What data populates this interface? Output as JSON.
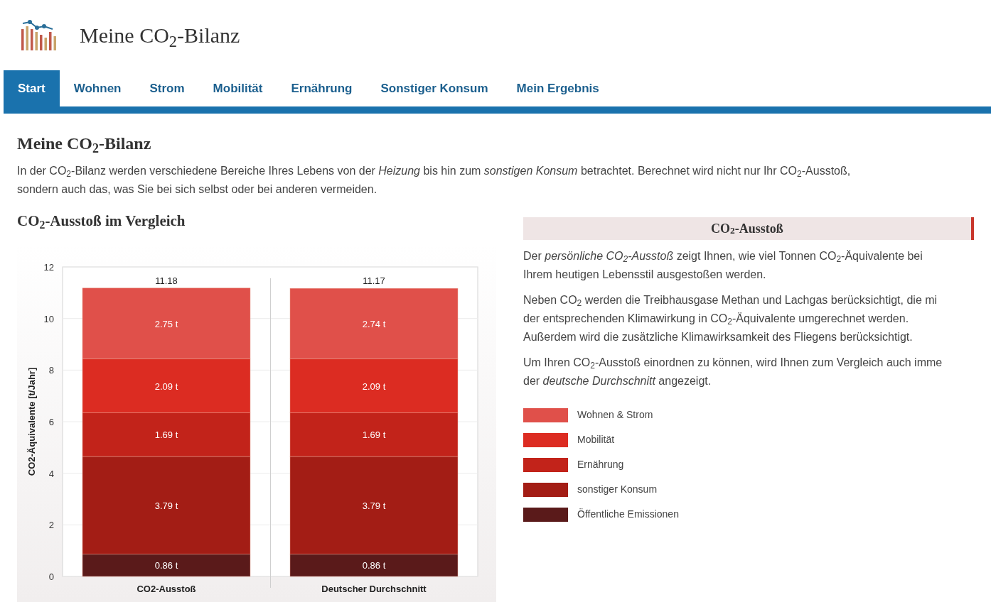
{
  "header": {
    "title": "Meine CO$_{2}$-Bilanz"
  },
  "tabs": [
    {
      "label": "Start",
      "selected": true
    },
    {
      "label": "Wohnen",
      "selected": false
    },
    {
      "label": "Strom",
      "selected": false
    },
    {
      "label": "Mobilität",
      "selected": false
    },
    {
      "label": "Ernährung",
      "selected": false
    },
    {
      "label": "Sonstiger Konsum",
      "selected": false
    },
    {
      "label": "Mein Ergebnis",
      "selected": false
    }
  ],
  "intro": {
    "heading": "Meine CO$_{2}$-Bilanz",
    "lines": [
      "In der CO$_{2}$-Bilanz werden verschiedene Bereiche Ihres Lebens von der *Heizung* bis hin zum *sonstigen Konsum* betrachtet. Berechnet wird nicht nur Ihr CO$_{2}$-Ausstoß,",
      "sondern auch das, was Sie bei sich selbst oder bei anderen vermeiden."
    ]
  },
  "comparison": {
    "heading": "CO$_{2}$-Ausstoß im Vergleich",
    "chart_data": {
      "type": "bar",
      "stacked": true,
      "grid": true,
      "ylabel": "CO2-Äquivalente [t/Jahr]",
      "categories": [
        "CO2-Ausstoß",
        "Deutscher Durchschnitt"
      ],
      "ylim": [
        0,
        12
      ],
      "yticks": [
        0,
        2,
        4,
        6,
        8,
        10,
        12
      ],
      "series": [
        {
          "name": "Öffentliche Emissionen",
          "color": "#5a1a1a",
          "values": [
            0.86,
            0.86
          ],
          "value_labels": [
            "0.86 t",
            "0.86 t"
          ]
        },
        {
          "name": "sonstiger Konsum",
          "color": "#a31d15",
          "values": [
            3.79,
            3.79
          ],
          "value_labels": [
            "3.79 t",
            "3.79 t"
          ]
        },
        {
          "name": "Ernährung",
          "color": "#c2231a",
          "values": [
            1.69,
            1.69
          ],
          "value_labels": [
            "1.69 t",
            "1.69 t"
          ]
        },
        {
          "name": "Mobilität",
          "color": "#dc2c22",
          "values": [
            2.09,
            2.09
          ],
          "value_labels": [
            "2.09 t",
            "2.09 t"
          ]
        },
        {
          "name": "Wohnen & Strom",
          "color": "#e0504a",
          "values": [
            2.75,
            2.74
          ],
          "value_labels": [
            "2.75 t",
            "2.74 t"
          ]
        }
      ],
      "annotations": [
        "11.18",
        "11.17"
      ]
    }
  },
  "info": {
    "heading": "CO$_{2}$-Ausstoß",
    "paragraphs": [
      {
        "lines": [
          "Der *persönliche CO$_{2}$-Ausstoß* zeigt Ihnen, wie viel Tonnen CO$_{2}$-Äquivalente bei",
          "Ihrem heutigen Lebensstil ausgestoßen werden."
        ]
      },
      {
        "lines": [
          "Neben CO$_{2}$ werden die Treibhausgase Methan und Lachgas berücksichtigt, die mi",
          "der entsprechenden Klimawirkung in CO$_{2}$-Äquivalente umgerechnet werden.",
          "Außerdem wird die zusätzliche Klimawirksamkeit des Fliegens berücksichtigt."
        ]
      },
      {
        "lines": [
          "Um Ihren CO$_{2}$-Ausstoß einordnen zu können, wird Ihnen zum Vergleich auch imme",
          "der *deutsche Durchschnitt* angezeigt."
        ]
      }
    ]
  }
}
